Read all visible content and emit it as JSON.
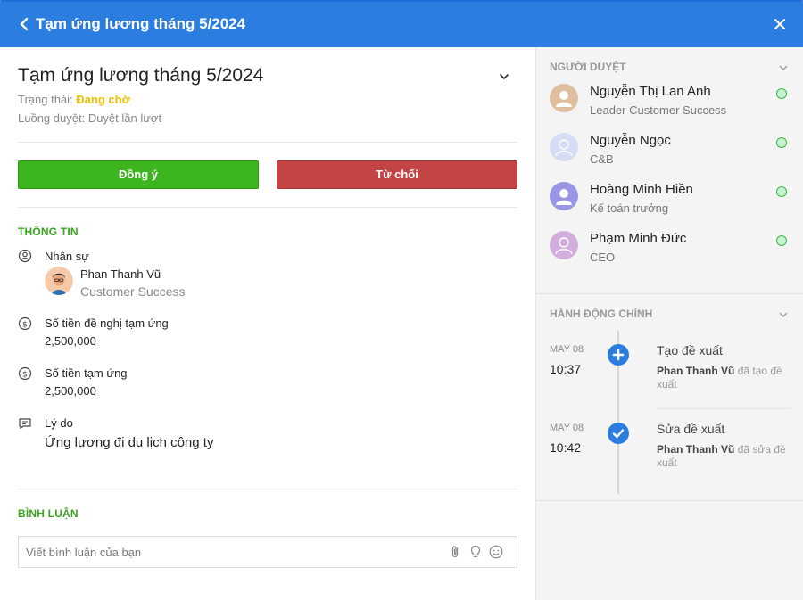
{
  "header": {
    "title": "Tạm ứng lương tháng 5/2024"
  },
  "request": {
    "title": "Tạm ứng lương tháng 5/2024",
    "status_label": "Trạng thái:",
    "status_value": "Đang chờ",
    "flow_label": "Luồng duyệt:",
    "flow_value": "Duyệt lần lượt"
  },
  "actions": {
    "approve": "Đồng ý",
    "reject": "Từ chối"
  },
  "info": {
    "section_title": "THÔNG TIN",
    "employee_label": "Nhân sự",
    "employee_name": "Phan Thanh Vũ",
    "employee_dept": "Customer Success",
    "requested_label": "Số tiền đề nghị tạm ứng",
    "requested_value": "2,500,000",
    "advance_label": "Số tiền tạm ứng",
    "advance_value": "2,500,000",
    "reason_label": "Lý do",
    "reason_value": "Ứng lương đi du lịch công ty"
  },
  "comments": {
    "section_title": "BÌNH LUẬN",
    "placeholder": "Viết bình luận của bạn"
  },
  "approvers": {
    "title": "NGƯỜI DUYỆT",
    "items": [
      {
        "name": "Nguyễn Thị Lan Anh",
        "role": "Leader Customer Success",
        "color": "#e0bfa0"
      },
      {
        "name": "Nguyễn Ngọc",
        "role": "C&B",
        "color": "#d7dcf5"
      },
      {
        "name": "Hoàng Minh Hiền",
        "role": "Kế toán trưởng",
        "color": "#9b95e6"
      },
      {
        "name": "Phạm Minh Đức",
        "role": "CEO",
        "color": "#d2aede"
      }
    ]
  },
  "activity": {
    "title": "HÀNH ĐỘNG CHÍNH",
    "items": [
      {
        "date": "MAY 08",
        "time": "10:37",
        "action": "Tạo đề xuất",
        "actor": "Phan Thanh Vũ",
        "verb": "đã tạo đề xuất",
        "icon": "plus-icon"
      },
      {
        "date": "MAY 08",
        "time": "10:42",
        "action": "Sửa đề xuất",
        "actor": "Phan Thanh Vũ",
        "verb": "đã sửa đề xuất",
        "icon": "check-icon"
      }
    ]
  },
  "colors": {
    "header": "#2b7de0",
    "approve": "#3db51f",
    "reject": "#c24444",
    "status_pending": "#f0c000",
    "section": "#3aa51e"
  }
}
